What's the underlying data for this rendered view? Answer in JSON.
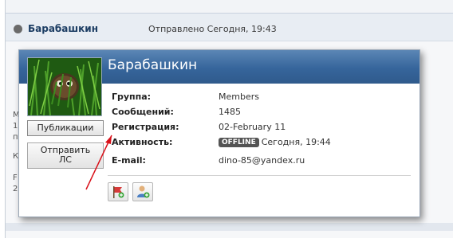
{
  "post": {
    "author": "Барабашкин",
    "sent": "Отправлено Сегодня, 19:43",
    "peek_letters": [
      "М",
      "1",
      "п",
      "К",
      "F",
      "2"
    ]
  },
  "popup": {
    "name": "Барабашкин",
    "buttons": {
      "publications": "Публикации",
      "send_pm_line1": "Отправить",
      "send_pm_line2": "ЛС"
    },
    "fields": [
      {
        "label": "Группа:",
        "value": "Members"
      },
      {
        "label": "Сообщений:",
        "value": "1485"
      },
      {
        "label": "Регистрация:",
        "value": "02-February 11"
      },
      {
        "label": "Активность:",
        "badge": "OFFLINE",
        "value": "Сегодня, 19:44"
      },
      {
        "label": "E-mail:",
        "value": "dino-85@yandex.ru"
      }
    ],
    "action_icons": [
      "flag-warn-icon",
      "add-friend-icon"
    ]
  },
  "colors": {
    "header_blue": "#36659b",
    "badge_gray": "#545454",
    "arrow_red": "#d9111a"
  }
}
